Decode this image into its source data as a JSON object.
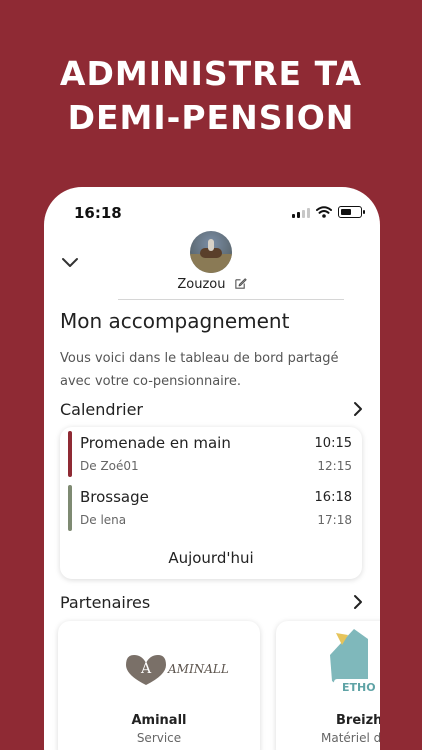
{
  "headline": [
    "ADMINISTRE TA",
    "DEMI-PENSION"
  ],
  "status_bar": {
    "time": "16:18",
    "battery_level": 0.6
  },
  "profile": {
    "name": "Zouzou"
  },
  "page": {
    "title": "Mon accompagnement",
    "intro": "Vous voici dans le tableau de bord partagé avec votre co-pensionnaire."
  },
  "calendar": {
    "label": "Calendrier",
    "events": [
      {
        "title": "Promenade en main",
        "subtitle": "De Zoé01",
        "start": "10:15",
        "end": "12:15",
        "color": "#8f2a34"
      },
      {
        "title": "Brossage",
        "subtitle": "De lena",
        "start": "16:18",
        "end": "17:18",
        "color": "#7e8a72"
      }
    ],
    "today_label": "Aujourd'hui"
  },
  "partners": {
    "label": "Partenaires",
    "items": [
      {
        "name": "Aminall",
        "category": "Service",
        "logo_text": "AMINALL"
      },
      {
        "name": "Breizh",
        "category": "Matériel d'",
        "logo_text": "ETHO"
      }
    ]
  },
  "colors": {
    "brand": "#8f2a34",
    "accent_green": "#7e8a72",
    "partner_teal": "#5fa3a6"
  },
  "icons": [
    "chevron-down-icon",
    "edit-icon",
    "chevron-right-icon",
    "wifi-icon",
    "battery-icon",
    "signal-icon"
  ]
}
